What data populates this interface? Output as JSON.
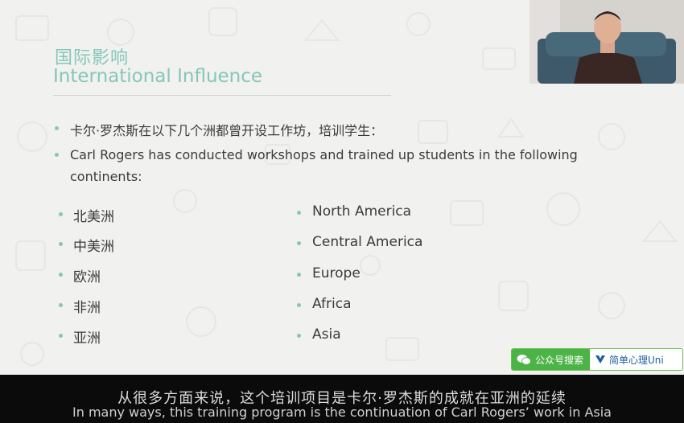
{
  "slide": {
    "title_cn": "国际影响",
    "title_en": "International Influence",
    "intro_cn": "卡尔·罗杰斯在以下几个洲都曾开设工作坊，培训学生：",
    "intro_en_line1": "Carl Rogers has conducted workshops and trained up students in the following",
    "intro_en_line2": "continents:",
    "continents_cn": [
      "北美洲",
      "中美洲",
      "欧洲",
      "非洲",
      "亚洲"
    ],
    "continents_en": [
      "North America",
      "Central America",
      "Europe",
      "Africa",
      "Asia"
    ]
  },
  "badge": {
    "left_label": "公众号搜索",
    "right_label": "简单心理Uni"
  },
  "subtitles": {
    "cn": "从很多方面来说，这个培训项目是卡尔·罗杰斯的成就在亚洲的延续",
    "en": "In many ways, this training program is the continuation of Carl Rogers’ work in Asia"
  },
  "colors": {
    "accent": "#86c6b9",
    "badge_green": "#4cb347",
    "subtitle_bg": "#0b0b0b"
  }
}
